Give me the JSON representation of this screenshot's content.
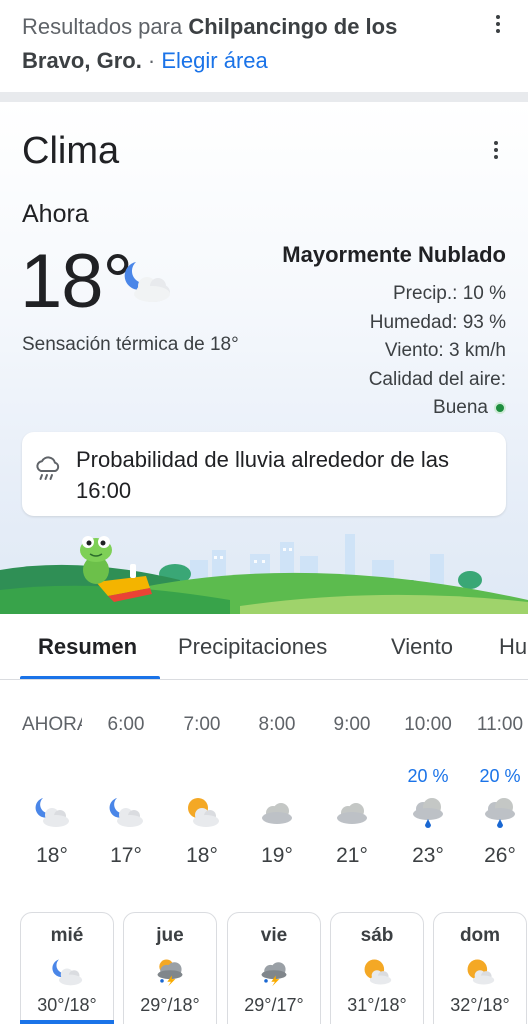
{
  "header": {
    "results_prefix": "Resultados para ",
    "location": "Chilpancingo de los Bravo, Gro.",
    "separator": " · ",
    "change_area": "Elegir área",
    "menu_icon": "more-vert-icon"
  },
  "weather": {
    "title": "Clima",
    "now_label": "Ahora",
    "temperature": "18°",
    "current_icon": "moon-cloud-icon",
    "feels_like": "Sensación térmica de 18°",
    "condition": "Mayormente Nublado",
    "precip": "Precip.: 10 %",
    "humidity": "Humedad: 93 %",
    "wind": "Viento: 3 km/h",
    "air_quality_label": "Calidad del aire:",
    "air_quality_value": "Buena",
    "air_quality_color": "#1e8e3e",
    "rain_icon": "rain-cloud-icon",
    "rain_notice": "Probabilidad de lluvia alrededor de las 16:00"
  },
  "tabs": [
    {
      "label": "Resumen",
      "active": true
    },
    {
      "label": "Precipitaciones",
      "active": false
    },
    {
      "label": "Viento",
      "active": false
    },
    {
      "label": "Hu",
      "active": false
    }
  ],
  "hourly": [
    {
      "time": "AHORA",
      "prob": "",
      "icon": "moon-cloud-icon",
      "temp": "18°"
    },
    {
      "time": "6:00",
      "prob": "",
      "icon": "moon-cloud-icon",
      "temp": "17°"
    },
    {
      "time": "7:00",
      "prob": "",
      "icon": "sun-cloud-icon",
      "temp": "18°"
    },
    {
      "time": "8:00",
      "prob": "",
      "icon": "cloud-icon",
      "temp": "19°"
    },
    {
      "time": "9:00",
      "prob": "",
      "icon": "cloud-icon",
      "temp": "21°"
    },
    {
      "time": "10:00",
      "prob": "20 %",
      "icon": "rain-icon",
      "temp": "23°"
    },
    {
      "time": "11:00",
      "prob": "20 %",
      "icon": "rain-icon",
      "temp": "26°"
    }
  ],
  "daily": [
    {
      "day": "mié",
      "icon": "moon-cloud-icon",
      "range": "30°/18°",
      "active": true
    },
    {
      "day": "jue",
      "icon": "thunderstorm-icon",
      "range": "29°/18°",
      "active": false
    },
    {
      "day": "vie",
      "icon": "thunderstorm-icon",
      "range": "29°/17°",
      "active": false
    },
    {
      "day": "sáb",
      "icon": "sun-cloud-icon",
      "range": "31°/18°",
      "active": false
    },
    {
      "day": "dom",
      "icon": "sun-cloud-icon",
      "range": "32°/18°",
      "active": false
    }
  ],
  "colors": {
    "accent": "#1a73e8",
    "probability": "#1a73e8"
  }
}
